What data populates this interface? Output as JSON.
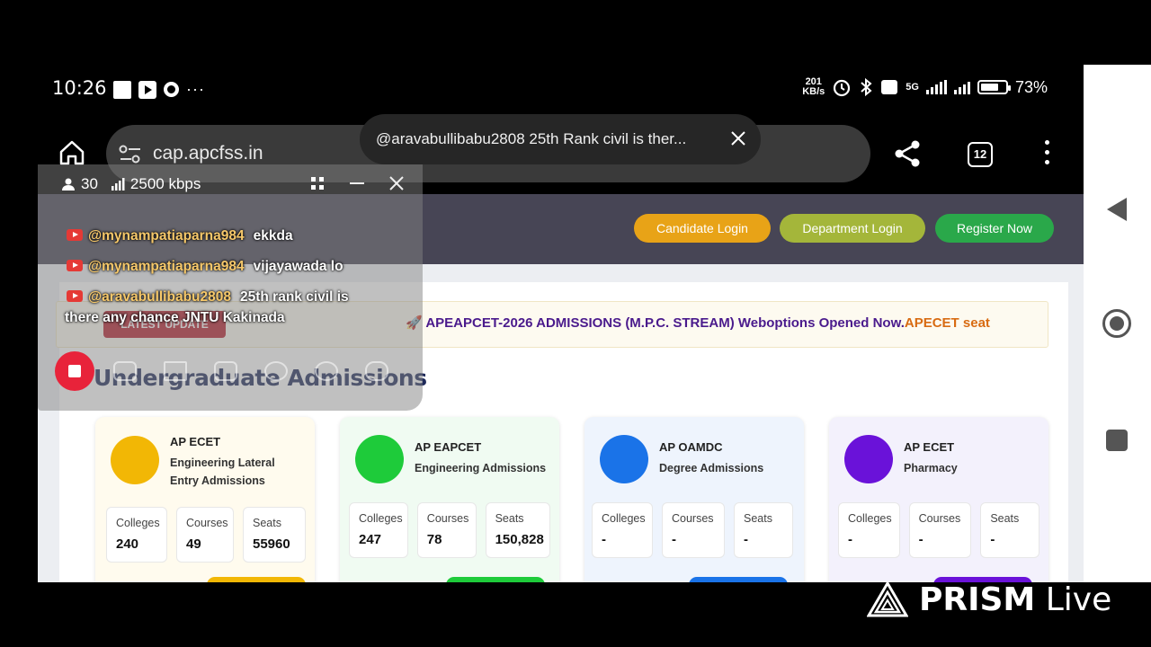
{
  "status_bar": {
    "time": "10:26",
    "dots": "···",
    "net_speed_value": "201",
    "net_speed_unit": "KB/s",
    "network": "5G",
    "battery": "73%",
    "battery_level": 0.73
  },
  "browser": {
    "url": "cap.apcfss.in",
    "tab_count": "12"
  },
  "toast": {
    "text": "@aravabullibabu2808  25th Rank civil is ther..."
  },
  "live_panel": {
    "viewers": "30",
    "bitrate": "2500 kbps",
    "chat": [
      {
        "user": "@mynampatiaparna984",
        "message": "ekkda"
      },
      {
        "user": "@mynampatiaparna984",
        "message": "vijayawada lo"
      },
      {
        "user": "@aravabullibabu2808",
        "message": "25th rank civil is"
      }
    ],
    "chat_continuation": "there any chance JNTU Kakinada"
  },
  "site": {
    "header_buttons": {
      "candidate_login": "Candidate Login",
      "department_login": "Department Login",
      "register_now": "Register Now"
    },
    "latest_update_label": "LATEST UPDATE",
    "marquee_main": "APEAPCET-2026 ADMISSIONS (M.P.C. STREAM) Weboptions Opened Now.",
    "marquee_tail": "APECET seat",
    "section_title": "Undergraduate Admissions",
    "programs": [
      {
        "name": "AP ECET",
        "subtitle_1": "Engineering Lateral",
        "subtitle_2": "Entry Admissions",
        "colleges_label": "Colleges",
        "colleges": "240",
        "courses_label": "Courses",
        "courses": "49",
        "seats_label": "Seats",
        "seats": "55960",
        "color": "#f2b705"
      },
      {
        "name": "AP EAPCET",
        "subtitle_1": "Engineering Admissions",
        "subtitle_2": "",
        "colleges_label": "Colleges",
        "colleges": "247",
        "courses_label": "Courses",
        "courses": "78",
        "seats_label": "Seats",
        "seats": "150,828",
        "color": "#1ecb3a"
      },
      {
        "name": "AP OAMDC",
        "subtitle_1": "Degree Admissions",
        "subtitle_2": "",
        "colleges_label": "Colleges",
        "colleges": "-",
        "courses_label": "Courses",
        "courses": "-",
        "seats_label": "Seats",
        "seats": "-",
        "color": "#1a73e8"
      },
      {
        "name": "AP ECET",
        "subtitle_1": "Pharmacy",
        "subtitle_2": "",
        "colleges_label": "Colleges",
        "colleges": "-",
        "courses_label": "Courses",
        "courses": "-",
        "seats_label": "Seats",
        "seats": "-",
        "color": "#6a12d9"
      }
    ]
  },
  "watermark": {
    "brand": "PRISM",
    "suffix": "Live"
  }
}
